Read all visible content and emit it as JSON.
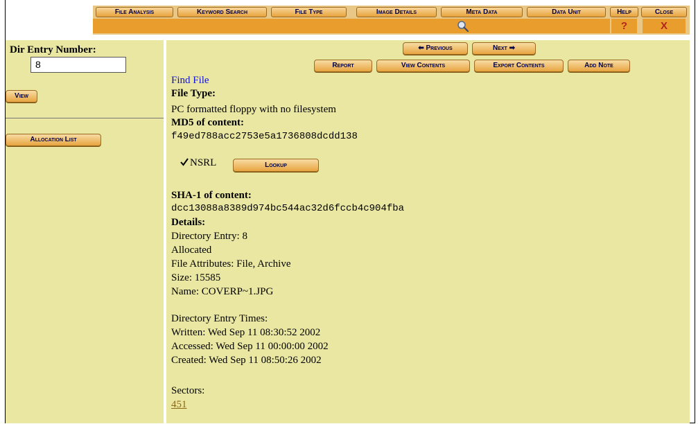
{
  "nav": {
    "file_analysis": "File Analysis",
    "keyword_search": "Keyword Search",
    "file_type": "File Type",
    "image_details": "Image Details",
    "meta_data": "Meta Data",
    "data_unit": "Data Unit",
    "help": "Help",
    "close": "Close",
    "help_symbol": "?",
    "close_symbol": "X",
    "search_icon": "magnifier-icon"
  },
  "left": {
    "dir_entry_label": "Dir Entry Number:",
    "dir_entry_value": "8",
    "view_button": "View",
    "allocation_list_button": "Allocation List"
  },
  "toolbar": {
    "previous": "Previous",
    "next": "Next",
    "report": "Report",
    "view_contents": "View Contents",
    "export_contents": "Export Contents",
    "add_note": "Add Note"
  },
  "content": {
    "find_file": "Find File",
    "file_type_label": "File Type:",
    "file_type_value": "PC formatted floppy with no filesystem",
    "md5_label": "MD5 of content:",
    "md5_value": "f49ed788acc2753e5a1736808dcdd138",
    "nsrl_label": "NSRL",
    "nsrl_checked": true,
    "lookup_button": "Lookup",
    "sha1_label": "SHA-1 of content:",
    "sha1_value": "dcc13088a8389d974bc544ac32d6fccb4c904fba",
    "details_label": "Details:",
    "details": [
      "Directory Entry: 8",
      "Allocated",
      "File Attributes: File, Archive",
      "Size: 15585",
      "Name: COVERP~1.JPG"
    ],
    "times_label": "Directory Entry Times:",
    "times": [
      "Written: Wed Sep 11 08:30:52 2002",
      "Accessed: Wed Sep 11 00:00:00 2002",
      "Created: Wed Sep 11 08:50:26 2002"
    ],
    "sectors_label": "Sectors:",
    "sector_link": "451"
  },
  "colors": {
    "panel_bg": "#eae7a2",
    "nav_bg": "#e9c887",
    "nav_sub": "#e89d2c",
    "button_text": "#000044",
    "link_blue": "#1010d0",
    "link_sector": "#8b6914"
  }
}
